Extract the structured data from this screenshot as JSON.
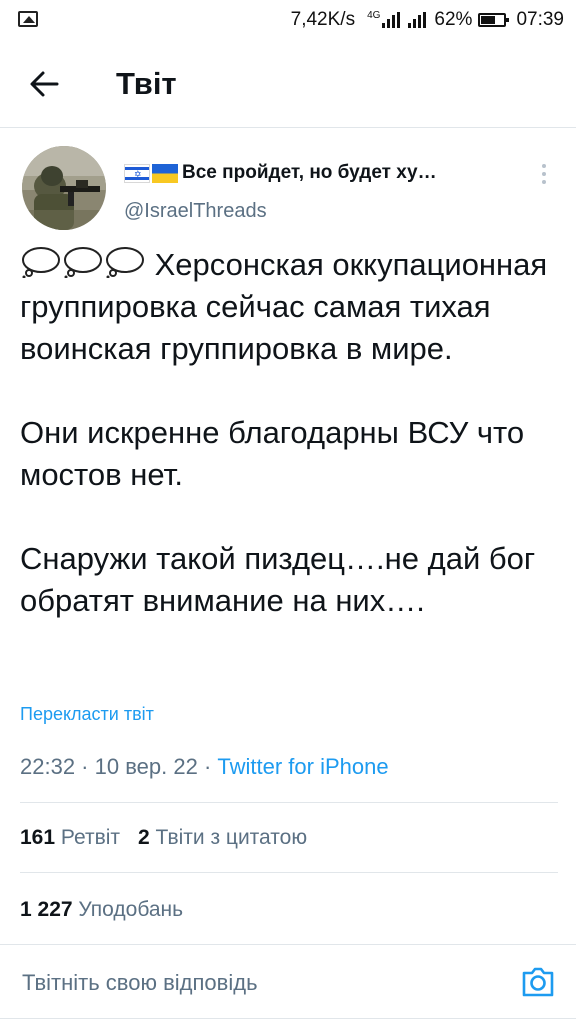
{
  "status_bar": {
    "speed": "7,42K/s",
    "network": "4G",
    "battery": "62%",
    "time": "07:39"
  },
  "header": {
    "title": "Твіт",
    "back_icon": "arrow-left-icon"
  },
  "tweet": {
    "display_name": "Все пройдет, но будет ху…",
    "handle": "@IsraelThreads",
    "text_line1": "Херсонская оккупационная группировка сейчас самая тихая воинская группировка в мире.",
    "text_line2": "Они искренне благодарны ВСУ что мостов нет.",
    "text_line3": "Снаружи такой пиздец….не дай бог обратят внимание на них….",
    "translate_label": "Перекласти твіт",
    "time": "22:32",
    "date": "10 вер. 22",
    "source": "Twitter for iPhone"
  },
  "stats": {
    "retweets_count": "161",
    "retweets_label": "Ретвіт",
    "quotes_count": "2",
    "quotes_label": "Твіти з цитатою",
    "likes_count": "1 227",
    "likes_label": "Уподобань"
  },
  "reply": {
    "placeholder": "Твітніть свою відповідь",
    "camera_icon": "camera-icon"
  },
  "colors": {
    "accent": "#1d9bf0",
    "secondary_text": "#5b7083",
    "divider": "#e1e6ea"
  }
}
